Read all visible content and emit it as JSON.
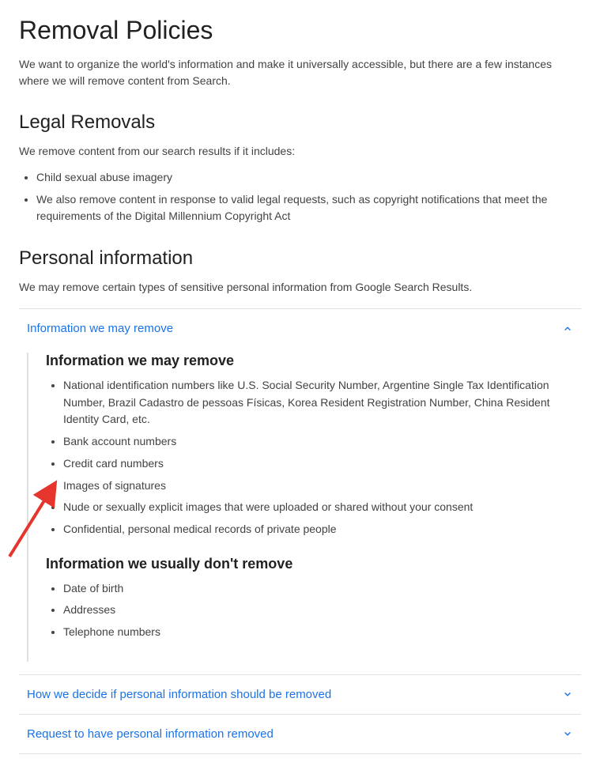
{
  "page": {
    "title": "Removal Policies",
    "intro": "We want to organize the world's information and make it universally accessible, but there are a few instances where we will remove content from Search."
  },
  "legal": {
    "heading": "Legal Removals",
    "text": "We remove content from our search results if it includes:",
    "items": [
      "Child sexual abuse imagery",
      "We also remove content in response to valid legal requests, such as copyright notifications that meet the requirements of the Digital Millennium Copyright Act"
    ]
  },
  "personal": {
    "heading": "Personal information",
    "text": "We may remove certain types of sensitive personal information from Google Search Results."
  },
  "accordion": {
    "expanded": {
      "title": "Information we may remove",
      "body_heading1": "Information we may remove",
      "may_remove": [
        "National identification numbers like U.S. Social Security Number, Argentine Single Tax Identification Number, Brazil Cadastro de pessoas Físicas, Korea Resident Registration Number, China Resident Identity Card, etc.",
        "Bank account numbers",
        "Credit card numbers",
        "Images of signatures",
        "Nude or sexually explicit images that were uploaded or shared without your consent",
        "Confidential, personal medical records of private people"
      ],
      "body_heading2": "Information we usually don't remove",
      "not_remove": [
        "Date of birth",
        "Addresses",
        "Telephone numbers"
      ]
    },
    "collapsed1": {
      "title": "How we decide if personal information should be removed"
    },
    "collapsed2": {
      "title": "Request to have personal information removed"
    }
  },
  "colors": {
    "link": "#1a73e8",
    "arrow": "#e5352d"
  }
}
